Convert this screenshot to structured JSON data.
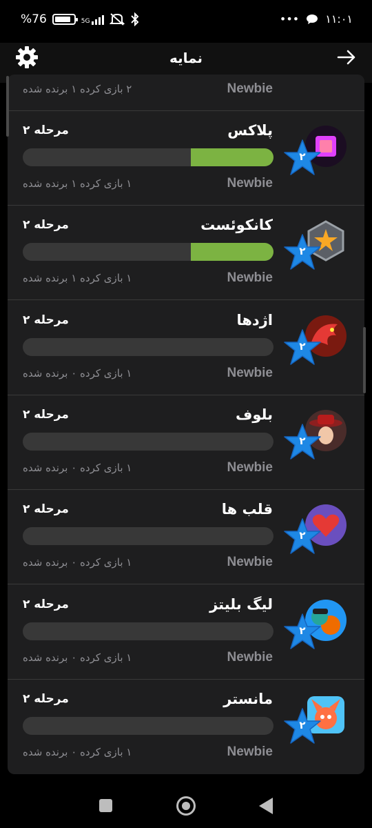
{
  "status": {
    "battery_text": "%76",
    "network": "5G",
    "time": "۱۱:۰۱",
    "dots": "•••"
  },
  "header": {
    "title": "نمایه"
  },
  "partial_row": {
    "rank": "Newbie",
    "stats": "۲ بازی کرده  ۱ برنده شده"
  },
  "games": [
    {
      "name": "پلاکس",
      "level": "مرحله ۲",
      "rank": "Newbie",
      "stats": "۱ بازی کرده  ۱ برنده شده",
      "progress": 0.33,
      "star": "۲",
      "icon": "plox-icon"
    },
    {
      "name": "کانکوئست",
      "level": "مرحله ۲",
      "rank": "Newbie",
      "stats": "۱ بازی کرده  ۱ برنده شده",
      "progress": 0.33,
      "star": "۲",
      "icon": "conquest-icon"
    },
    {
      "name": "اژدها",
      "level": "مرحله ۲",
      "rank": "Newbie",
      "stats": "۱ بازی کرده  ۰ برنده شده",
      "progress": 0,
      "star": "۲",
      "icon": "dragon-icon"
    },
    {
      "name": "بلوف",
      "level": "مرحله ۲",
      "rank": "Newbie",
      "stats": "۱ بازی کرده  ۰ برنده شده",
      "progress": 0,
      "star": "۲",
      "icon": "bluff-icon"
    },
    {
      "name": "قلب ها",
      "level": "مرحله ۲",
      "rank": "Newbie",
      "stats": "۱ بازی کرده  ۰ برنده شده",
      "progress": 0,
      "star": "۲",
      "icon": "hearts-icon"
    },
    {
      "name": "لیگ بلیتز",
      "level": "مرحله ۲",
      "rank": "Newbie",
      "stats": "۱ بازی کرده  ۰ برنده شده",
      "progress": 0,
      "star": "۲",
      "icon": "league-blitz-icon"
    },
    {
      "name": "مانستر",
      "level": "مرحله ۲",
      "rank": "Newbie",
      "stats": "۱ بازی کرده  ۰ برنده شده",
      "progress": 0,
      "star": "۲",
      "icon": "monster-icon"
    }
  ],
  "colors": {
    "progress_fill": "#7cb342",
    "star": "#1e88e5",
    "panel": "#1e1e1f"
  }
}
